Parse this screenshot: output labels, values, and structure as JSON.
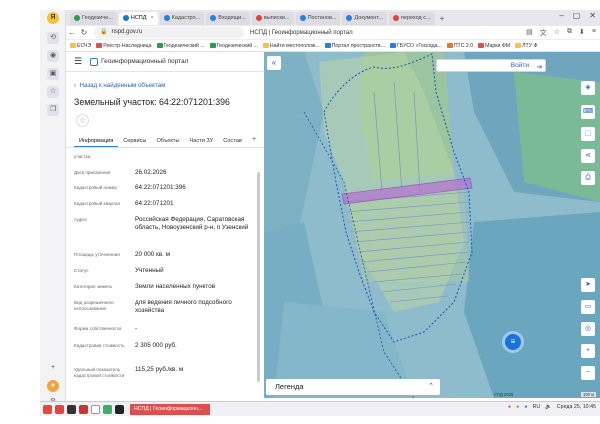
{
  "browser": {
    "tabs": [
      {
        "label": "Геодезиче...",
        "color": "#2e9a4a",
        "active": false
      },
      {
        "label": "НСПД",
        "color": "#1a73d9",
        "active": true
      },
      {
        "label": "Кадастро...",
        "color": "#2a7de1",
        "active": false
      },
      {
        "label": "Входящи...",
        "color": "#2a7de1",
        "active": false
      },
      {
        "label": "выписки...",
        "color": "#e0433a",
        "active": false
      },
      {
        "label": "Постанов...",
        "color": "#2a7de1",
        "active": false
      },
      {
        "label": "Документ...",
        "color": "#2a7de1",
        "active": false
      },
      {
        "label": "переход с...",
        "color": "#e0433a",
        "active": false
      }
    ],
    "url": "nspd.gov.ru",
    "page_title": "НСПД | Геоинформационный портал",
    "bookmarks": [
      "ЕСЧЭ",
      "Реестр-Наследница",
      "Геодезический ...",
      "Геодезический ...",
      "Найти местополож...",
      "Портал пространств...",
      "ГБУСО «Госкада...",
      "ПТС 2.0",
      "Марки ФМ",
      "ЛТУ Ф"
    ]
  },
  "app": {
    "portal_name": "Геоинформационный портал",
    "back_link": "Назад к найденным объектам",
    "object_title": "Земельный участок: 64:22:071201:396",
    "tabs": [
      "Информация",
      "Сервисы",
      "Объекты",
      "Части ЗУ",
      "Состав"
    ],
    "active_tab": "Информация",
    "rows": [
      {
        "label": "участка",
        "value": ""
      },
      {
        "label": "Дата присвоения",
        "value": "26.02.2026"
      },
      {
        "label": "Кадастровый номер",
        "value": "64:22:071201:396"
      },
      {
        "label": "Кадастровый квартал",
        "value": "64:22:071201"
      },
      {
        "label": "Адрес",
        "value": "Российская Федерация, Саратовская область, Новоузенский р-н, п Узенский"
      },
      {
        "label": "Площадь уточненная",
        "value": "20 000 кв. м"
      },
      {
        "label": "Статус",
        "value": "Учтенный"
      },
      {
        "label": "Категория земель",
        "value": "Земли населенных пунктов"
      },
      {
        "label": "Вид разрешенного использования",
        "value": "для ведения личного подсобного хозяйства"
      },
      {
        "label": "Форма собственности",
        "value": "-"
      },
      {
        "label": "Кадастровая стоимость",
        "value": "2 305 000 руб."
      },
      {
        "label": "Удельный показатель кадастровой стоимости",
        "value": "115,25 руб./кв. м"
      }
    ]
  },
  "map": {
    "login_label": "Войти",
    "legend_label": "Легенда",
    "crs_label": "СПД 2026",
    "scale_label": "100 м"
  },
  "taskbar": {
    "app_label": "НСПД | Геоинформационн...",
    "lang": "RU",
    "time": "Среда 25, 10:45"
  }
}
